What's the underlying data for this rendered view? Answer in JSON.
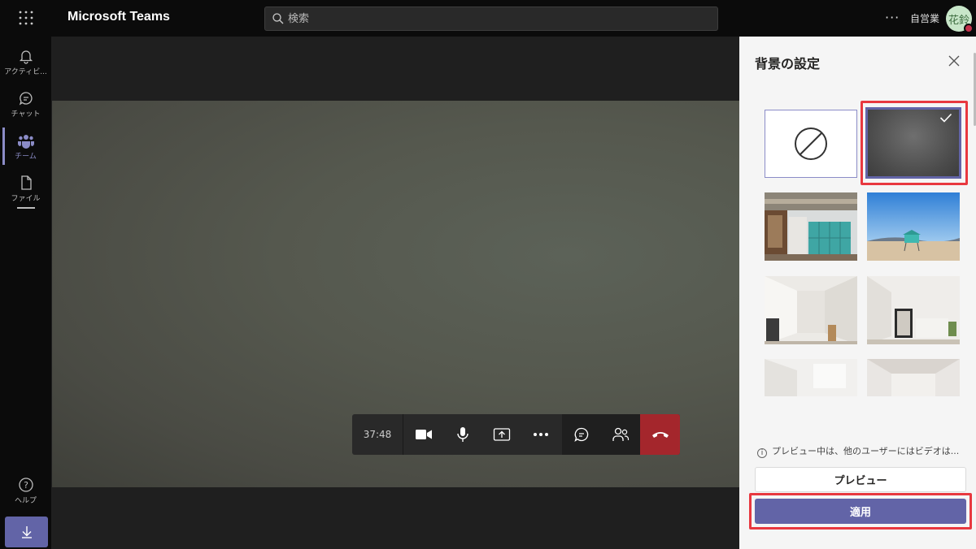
{
  "app": {
    "title": "Microsoft Teams"
  },
  "search": {
    "placeholder": "検索"
  },
  "header": {
    "more": "···",
    "org": "自営業",
    "avatar_initials": "花鈴"
  },
  "rail": {
    "items": [
      {
        "label": "アクティビ...",
        "icon": "bell-icon"
      },
      {
        "label": "チャット",
        "icon": "chat-icon"
      },
      {
        "label": "チーム",
        "icon": "teams-icon",
        "active": true
      },
      {
        "label": "ファイル",
        "icon": "file-icon"
      }
    ],
    "help_label": "ヘルプ"
  },
  "call": {
    "timer": "37:48",
    "buttons": [
      "camera-icon",
      "mic-icon",
      "share-screen-icon",
      "more-icon",
      "chat-icon",
      "participants-icon",
      "hang-up-icon"
    ]
  },
  "panel": {
    "title": "背景の設定",
    "backgrounds": [
      "none",
      "blur",
      "office-lockers",
      "beach-lifeguard",
      "white-room-1",
      "white-room-2",
      "white-room-3",
      "white-room-4"
    ],
    "selected": "blur",
    "info": "プレビュー中は、他のユーザーにはビデオは...",
    "preview_label": "プレビュー",
    "apply_label": "適用"
  },
  "colors": {
    "accent": "#6264a7",
    "hangup": "#a4262c",
    "highlight": "#e8383f"
  }
}
